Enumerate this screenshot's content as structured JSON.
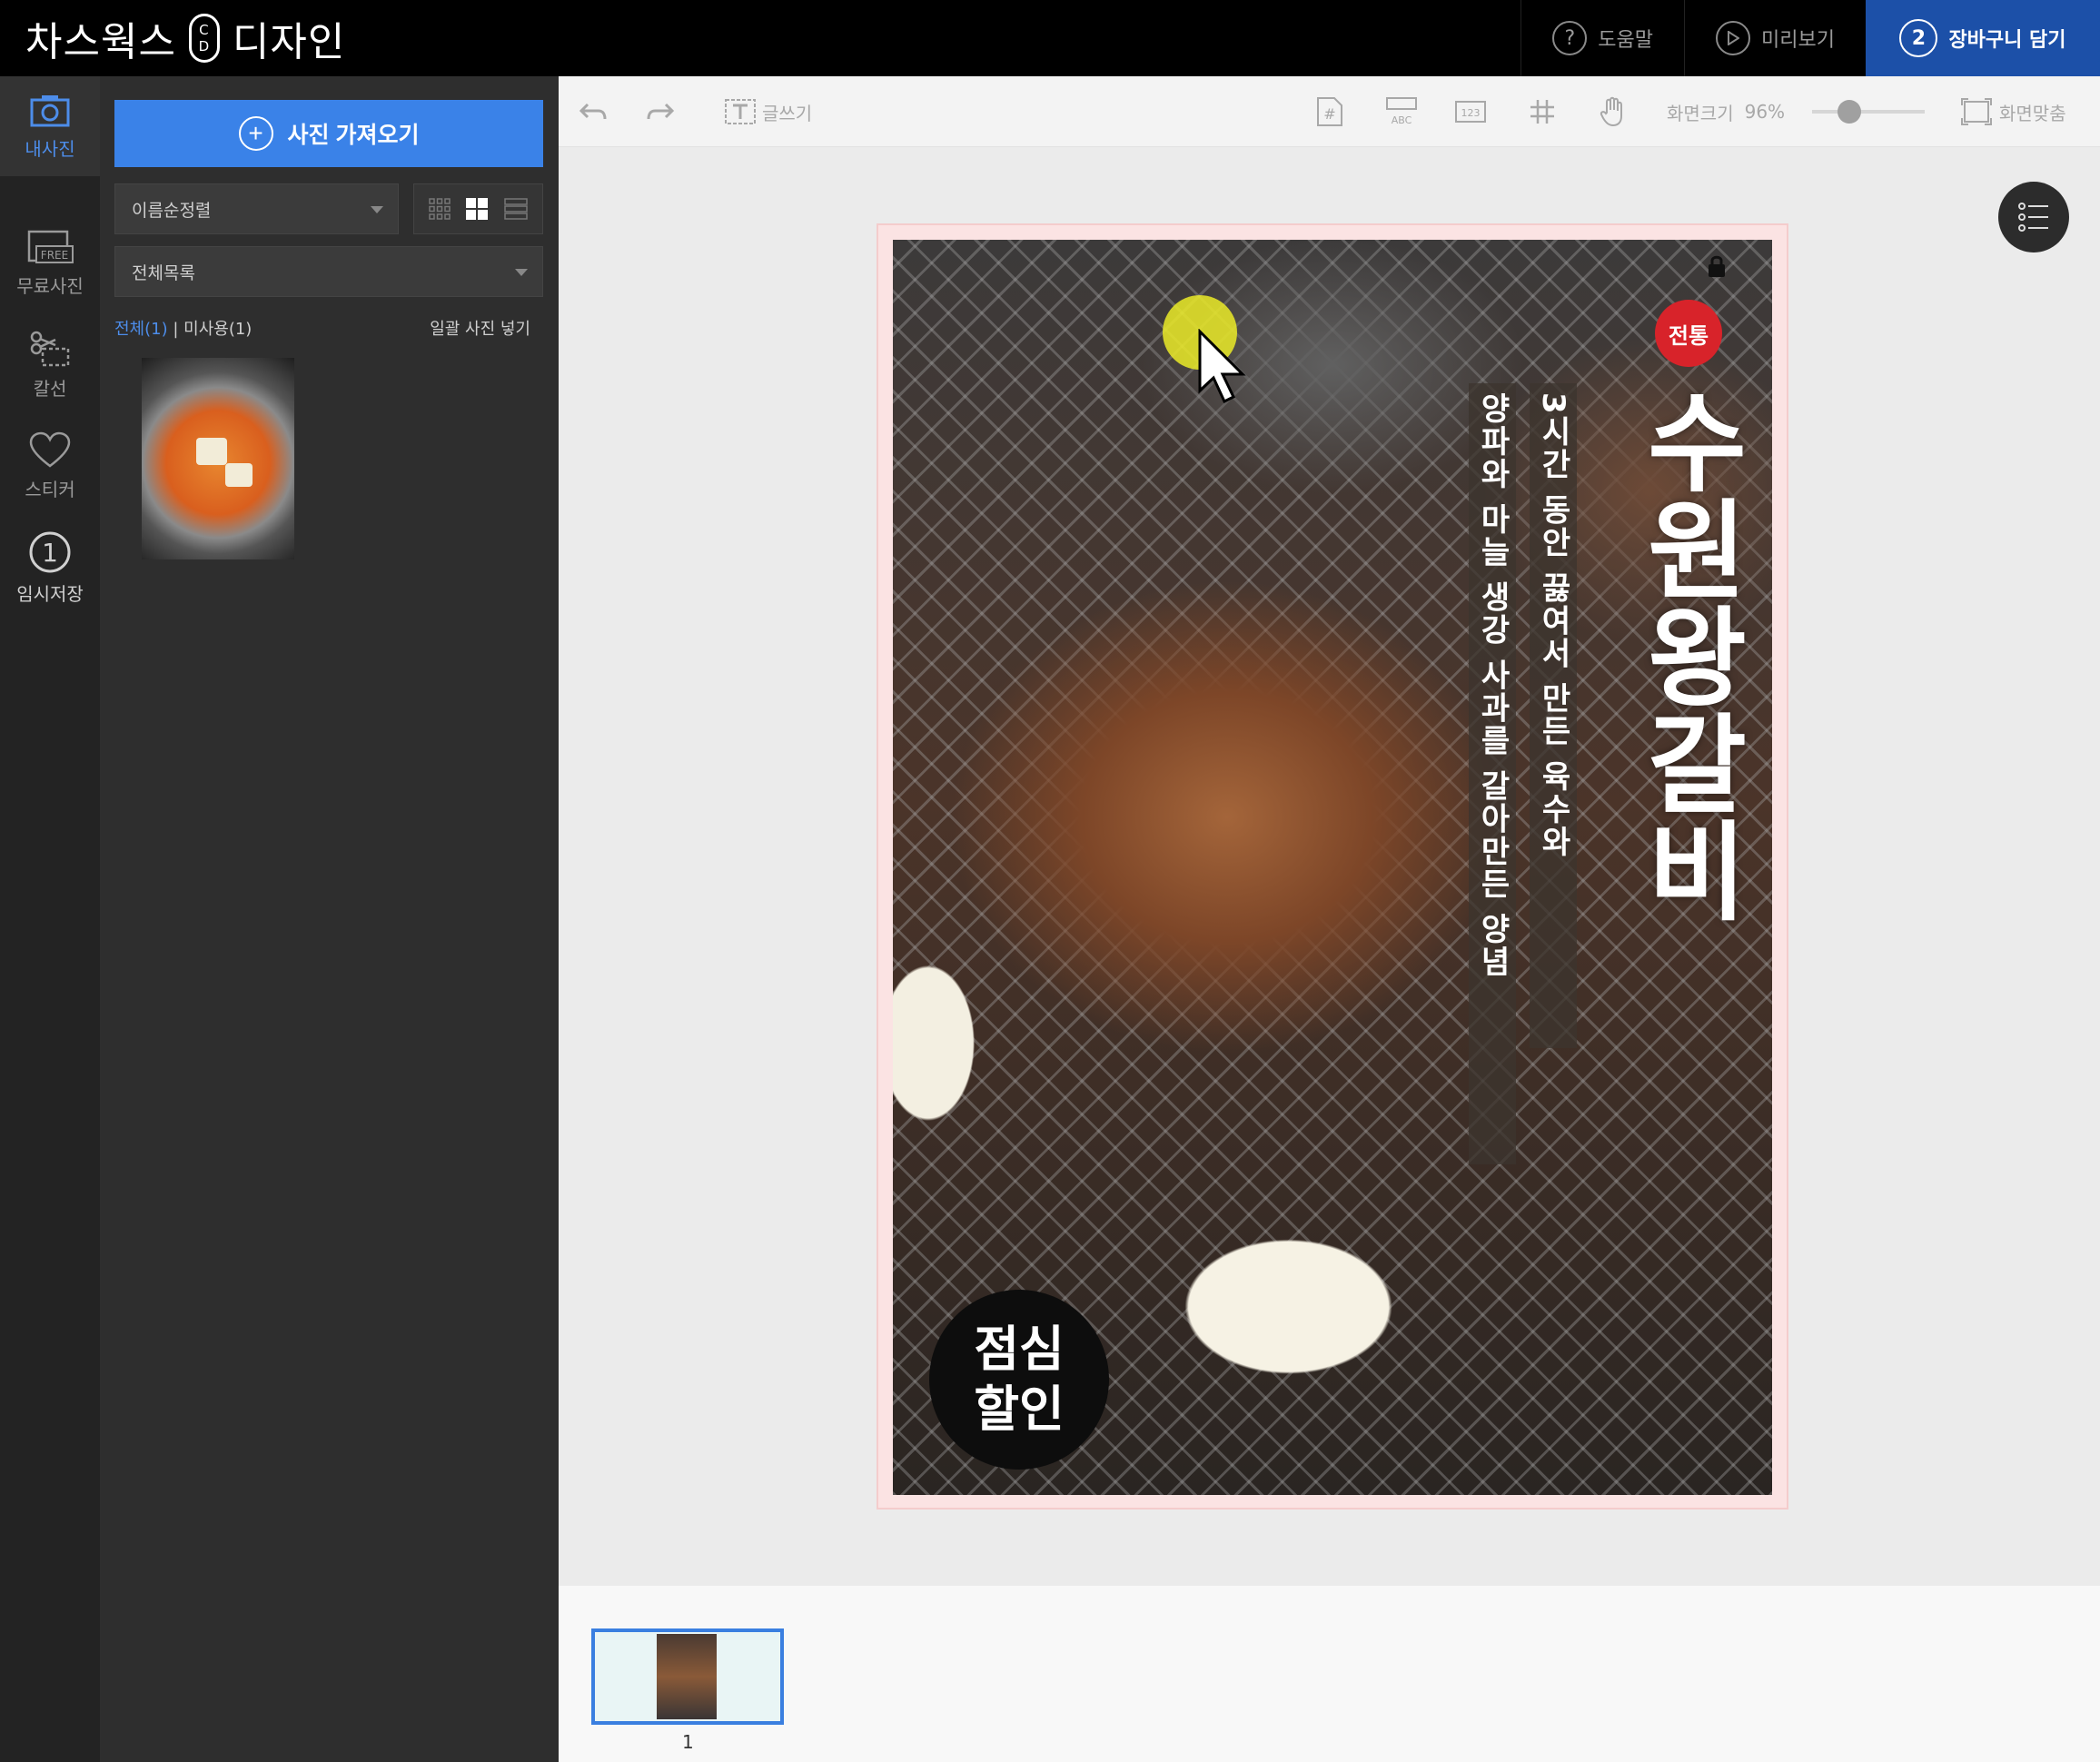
{
  "brand": {
    "left": "차스웍스",
    "mark_top": "C",
    "mark_bottom": "D",
    "right": "디자인"
  },
  "top_actions": {
    "help": {
      "icon": "?",
      "label": "도움말"
    },
    "preview": {
      "icon": "play-icon",
      "label": "미리보기"
    },
    "cart": {
      "step": "2",
      "label": "장바구니 담기"
    }
  },
  "rail": [
    {
      "id": "my-photos",
      "label": "내사진",
      "icon": "camera-icon"
    },
    {
      "id": "free-photos",
      "label": "무료사진",
      "icon": "free-image-icon",
      "icon_text": "FREE"
    },
    {
      "id": "cutline",
      "label": "칼선",
      "icon": "scissors-icon"
    },
    {
      "id": "sticker",
      "label": "스티커",
      "icon": "heart-icon"
    },
    {
      "id": "temp-save",
      "label": "임시저장",
      "icon": "number-one-icon",
      "icon_text": "1"
    }
  ],
  "panel": {
    "import_label": "사진 가져오기",
    "sort_value": "이름순정렬",
    "folder_value": "전체목록",
    "filter_all": "전체(1)",
    "filter_sep": " | ",
    "filter_unused": "미사용(1)",
    "bulk_insert": "일괄 사진 넣기"
  },
  "toolbar": {
    "write_text": "글쓰기",
    "zoom_label": "화면크기",
    "zoom_value": "96%",
    "fit_label": "화면맞춤",
    "abc": "ABC",
    "num": "123",
    "hash": "#"
  },
  "design": {
    "stamp": "전통",
    "title": "수원왕갈비",
    "band_right": "3시간 동안 끓여서 만든 육수와",
    "band_left": "양파와 마늘 생강 사과를 갈아만든 양념",
    "badge_line1": "점심",
    "badge_line2": "할인"
  },
  "pages": [
    {
      "number": "1"
    }
  ]
}
